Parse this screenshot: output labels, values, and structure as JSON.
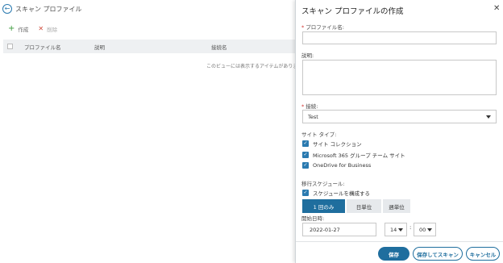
{
  "background": {
    "title": "スキャン プロファイル",
    "toolbar": {
      "create_label": "作成",
      "delete_label": "削除"
    },
    "table": {
      "columns": [
        "プロファイル名",
        "説明",
        "接続名"
      ],
      "empty_text": "このビューには表示するアイテムがありません"
    }
  },
  "panel": {
    "title": "スキャン プロファイルの作成",
    "profile_name": {
      "label": "プロファイル名:",
      "required": "*",
      "value": ""
    },
    "description": {
      "label": "説明:",
      "value": ""
    },
    "connection": {
      "label": "接続:",
      "required": "*",
      "selected": "Test"
    },
    "site_type": {
      "label": "サイト タイプ:",
      "options": [
        {
          "label": "サイト コレクション",
          "checked": true
        },
        {
          "label": "Microsoft 365 グループ チーム サイト",
          "checked": true
        },
        {
          "label": "OneDrive for Business",
          "checked": true
        }
      ]
    },
    "schedule": {
      "label": "移行スケジュール:",
      "configure_label": "スケジュールを構成する",
      "configure_checked": true,
      "frequency_tabs": [
        "1 回のみ",
        "日単位",
        "週単位"
      ],
      "active_tab": "1 回のみ",
      "start_time_label": "開始日時:",
      "date": "2022-01-27",
      "hour": "14",
      "minute": "00"
    },
    "footer": {
      "save_label": "保存",
      "save_and_scan_label": "保存してスキャン",
      "cancel_label": "キャンセル"
    }
  },
  "colors": {
    "accent": "#1f6e9e",
    "checkbox": "#2a7ab0",
    "required": "#d0312d",
    "header_bg": "#eef0f2"
  },
  "icons": {
    "back": "back-arrow-icon",
    "create": "plus-icon",
    "delete": "x-icon",
    "close": "close-icon",
    "dropdown": "chevron-down-icon",
    "checkbox": "checkmark-icon"
  }
}
